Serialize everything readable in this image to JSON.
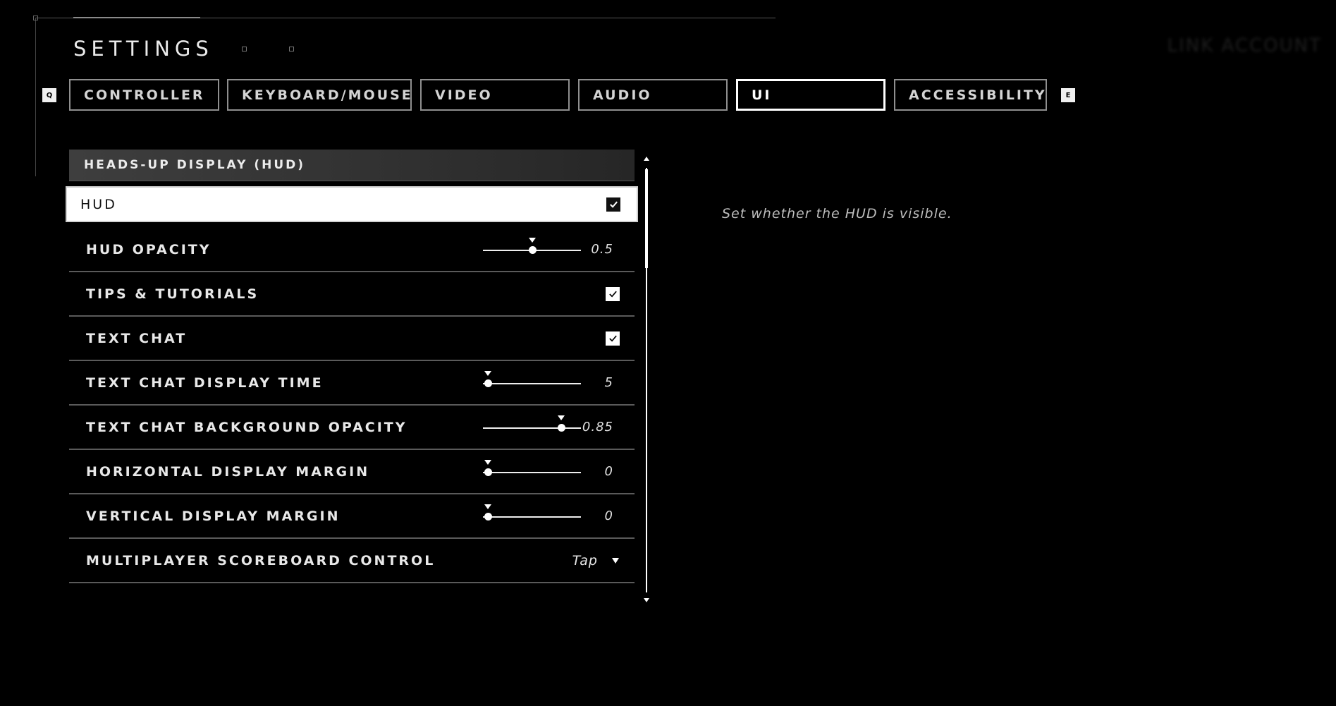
{
  "header": {
    "title": "SETTINGS",
    "top_right_text": "LINK ACCOUNT"
  },
  "tabs": {
    "prev_key": "Q",
    "next_key": "E",
    "items": [
      {
        "label": "CONTROLLER",
        "active": false
      },
      {
        "label": "KEYBOARD/MOUSE",
        "active": false
      },
      {
        "label": "VIDEO",
        "active": false
      },
      {
        "label": "AUDIO",
        "active": false
      },
      {
        "label": "UI",
        "active": true
      },
      {
        "label": "ACCESSIBILITY",
        "active": false
      }
    ]
  },
  "section": {
    "title": "HEADS-UP DISPLAY (HUD)"
  },
  "settings": [
    {
      "label": "HUD",
      "type": "checkbox",
      "checked": true,
      "selected": true
    },
    {
      "label": "HUD OPACITY",
      "type": "slider",
      "value": "0.5",
      "fraction": 0.5,
      "default_fraction": 0.5
    },
    {
      "label": "TIPS & TUTORIALS",
      "type": "checkbox",
      "checked": true
    },
    {
      "label": "TEXT CHAT",
      "type": "checkbox",
      "checked": true
    },
    {
      "label": "TEXT CHAT DISPLAY TIME",
      "type": "slider",
      "value": "5",
      "fraction": 0.05,
      "default_fraction": 0.05
    },
    {
      "label": "TEXT CHAT BACKGROUND OPACITY",
      "type": "slider",
      "value": "0.85",
      "fraction": 0.8,
      "default_fraction": 0.8
    },
    {
      "label": "HORIZONTAL DISPLAY MARGIN",
      "type": "slider",
      "value": "0",
      "fraction": 0.05,
      "default_fraction": 0.05
    },
    {
      "label": "VERTICAL DISPLAY MARGIN",
      "type": "slider",
      "value": "0",
      "fraction": 0.05,
      "default_fraction": 0.05
    },
    {
      "label": "MULTIPLAYER SCOREBOARD CONTROL",
      "type": "dropdown",
      "value": "Tap"
    }
  ],
  "description": "Set whether the HUD is visible.",
  "colors": {
    "background": "#000000",
    "accent": "#ffffff",
    "border": "#8f8f8f"
  }
}
